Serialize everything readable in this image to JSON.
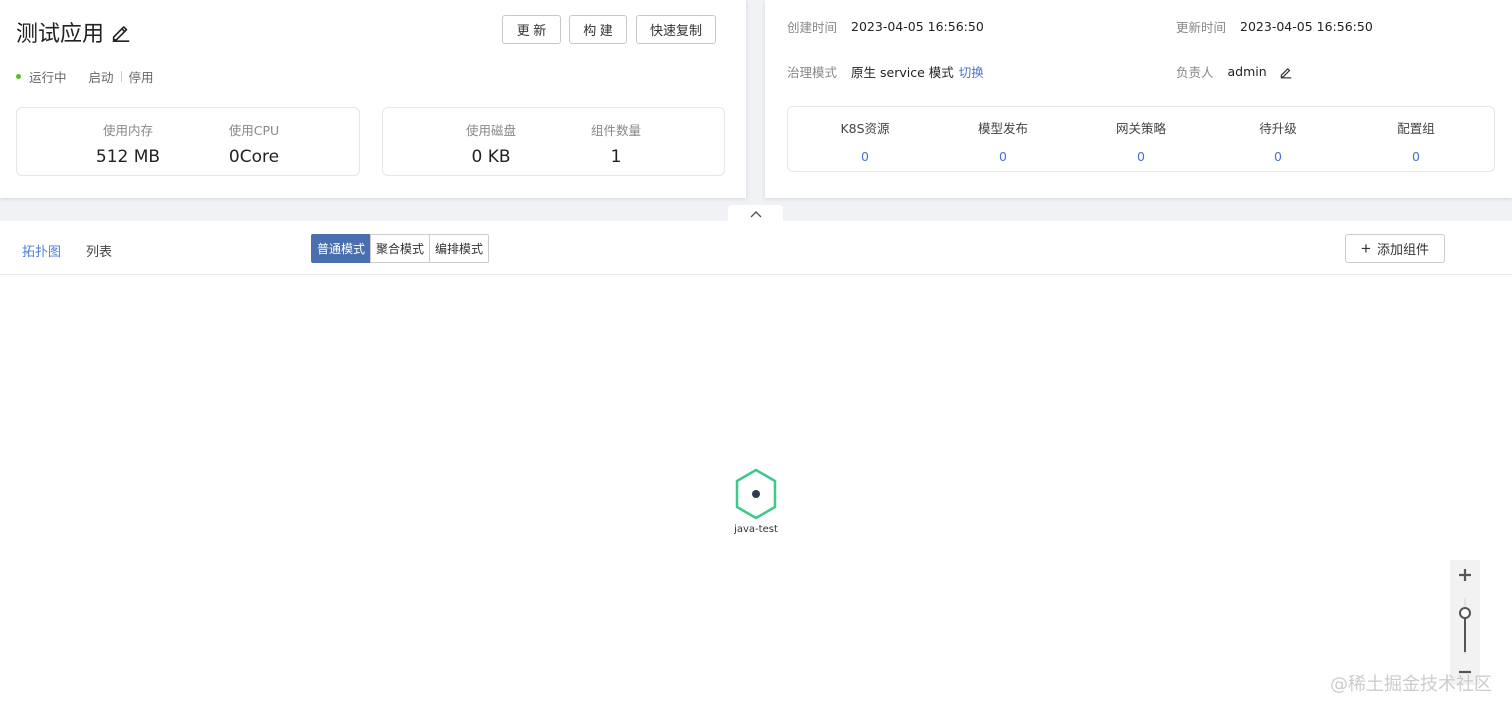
{
  "app": {
    "title": "测试应用",
    "status": "运行中",
    "actions": {
      "start": "启动",
      "stop": "停用"
    },
    "buttons": {
      "update": "更 新",
      "build": "构 建",
      "copy": "快速复制"
    }
  },
  "metrics": [
    {
      "label": "使用内存",
      "value": "512 MB"
    },
    {
      "label": "使用CPU",
      "value": "0Core"
    },
    {
      "label": "使用磁盘",
      "value": "0 KB"
    },
    {
      "label": "组件数量",
      "value": "1"
    }
  ],
  "info": {
    "created_label": "创建时间",
    "created_value": "2023-04-05 16:56:50",
    "updated_label": "更新时间",
    "updated_value": "2023-04-05 16:56:50",
    "governance_label": "治理模式",
    "governance_value": "原生 service 模式",
    "governance_switch": "切换",
    "owner_label": "负责人",
    "owner_value": "admin"
  },
  "stats": [
    {
      "label": "K8S资源",
      "value": "0"
    },
    {
      "label": "模型发布",
      "value": "0"
    },
    {
      "label": "网关策略",
      "value": "0"
    },
    {
      "label": "待升级",
      "value": "0"
    },
    {
      "label": "配置组",
      "value": "0"
    }
  ],
  "toolbar": {
    "tabs": [
      "拓扑图",
      "列表"
    ],
    "modes": [
      "普通模式",
      "聚合模式",
      "编排模式"
    ],
    "add_component": "添加组件"
  },
  "topology": {
    "nodes": [
      {
        "name": "java-test",
        "status_color": "#3ec98a"
      }
    ]
  },
  "zoom": {
    "level": 0.35
  },
  "watermark": "@稀土掘金技术社区",
  "colors": {
    "accent": "#4a6fd8",
    "running": "#52c41a",
    "node": "#3ec98a",
    "active_mode": "#4a6fae"
  }
}
